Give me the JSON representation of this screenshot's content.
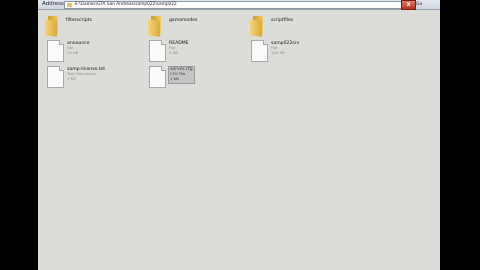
{
  "address_bar": {
    "label": "Address",
    "path": "E:\\Games\\GTA San Andreas\\samp022\\samp022",
    "go_label": "Go",
    "go_icon": "go-arrow-icon"
  },
  "close_label": "x",
  "items": [
    {
      "kind": "folder",
      "name": "filterscripts",
      "icon": "folder-icon"
    },
    {
      "kind": "folder",
      "name": "gamemodes",
      "icon": "folder-icon"
    },
    {
      "kind": "folder",
      "name": "scriptfiles",
      "icon": "folder-icon"
    },
    {
      "kind": "file",
      "name": "announce",
      "type": "File",
      "size": "12 KB",
      "icon": "file-icon"
    },
    {
      "kind": "file",
      "name": "README",
      "type": "File",
      "size": "2 KB",
      "icon": "file-icon"
    },
    {
      "kind": "file",
      "name": "samp022srv",
      "type": "File",
      "size": "135 KB",
      "icon": "file-icon"
    },
    {
      "kind": "file",
      "name": "samp-license.txt",
      "type": "Text Document",
      "size": "1 KB",
      "icon": "file-icon"
    },
    {
      "kind": "file",
      "name": "server.cfg",
      "type": "CFG File",
      "size": "1 KB",
      "icon": "file-icon",
      "selected": true
    }
  ]
}
